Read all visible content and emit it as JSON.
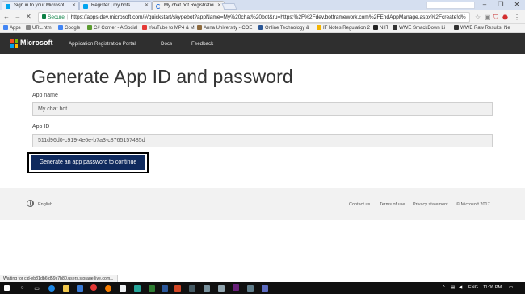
{
  "browser": {
    "tabs": [
      {
        "label": "Sign in to your Microsoft",
        "active": false
      },
      {
        "label": "Register | my bots",
        "active": false
      },
      {
        "label": "My chat bot Registration",
        "active": true
      }
    ],
    "secure_label": "Secure",
    "url": "https://apps.dev.microsoft.com/#/quickstart/skypebot?appName=My%20chat%20bot&ru=https:%2F%2Fdev.botframework.com%2FEndAppManage.aspx%2Fcreate!d%"
  },
  "bookmarks": [
    {
      "label": "Apps",
      "color": "#4285f4"
    },
    {
      "label": "URL.html",
      "color": "#888888"
    },
    {
      "label": "Google",
      "color": "#4285f4"
    },
    {
      "label": "C# Corner - A Social",
      "color": "#5b9b2f"
    },
    {
      "label": "YouTube to MP4 & M",
      "color": "#e53935"
    },
    {
      "label": "Anna University - COE",
      "color": "#8e6b3e"
    },
    {
      "label": "Online Technology &",
      "color": "#2b5797"
    },
    {
      "label": "IT Notes Regulation 2",
      "color": "#f4b400"
    },
    {
      "label": "NIIT",
      "color": "#222222"
    },
    {
      "label": "WWE SmackDown Li",
      "color": "#333333"
    },
    {
      "label": "WWE Raw Results, Ne",
      "color": "#333333"
    }
  ],
  "header": {
    "brand": "Microsoft",
    "nav": [
      "Application Registration Portal",
      "Docs",
      "Feedback"
    ],
    "logo_colors": [
      "#f25022",
      "#7fba00",
      "#00a4ef",
      "#ffb900"
    ]
  },
  "main": {
    "title": "Generate App ID and password",
    "app_name_label": "App name",
    "app_name_value": "My chat bot",
    "app_id_label": "App ID",
    "app_id_value": "511d96d0-c919-4e6e-b7a3-c8765157485d",
    "generate_button": "Generate an app password to continue"
  },
  "footer": {
    "language": "English",
    "links": [
      "Contact us",
      "Terms of use",
      "Privacy statement",
      "© Microsoft 2017"
    ]
  },
  "status": "Waiting for cid-eb81db6fd59c7b80.users.storage.live.com...",
  "taskbar": {
    "lang": "ENG",
    "time": "11:06 PM"
  }
}
